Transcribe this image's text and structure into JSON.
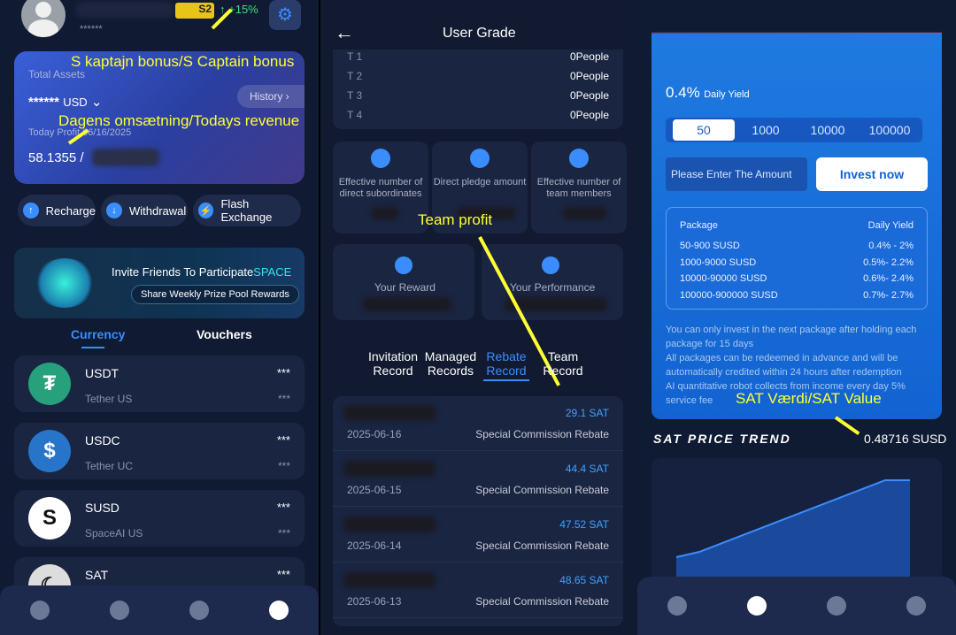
{
  "wallet": {
    "user_id_masked": "******",
    "level_badge": "S2",
    "growth": "+15%",
    "total_assets_label": "Total Assets",
    "assets_masked": "******",
    "currency": "USD",
    "history_label": "History",
    "today_profit_label": "Today Profit",
    "today_profit_date": "06/16/2025",
    "today_profit_value": "58.1355 /",
    "actions": [
      "Recharge",
      "Withdrawal",
      "Flash Exchange"
    ],
    "banner_title": "Invite Friends To Participate",
    "banner_highlight": "SPACE",
    "banner_button": "Share Weekly Prize Pool Rewards",
    "tabs": [
      "Currency",
      "Vouchers"
    ],
    "coins": [
      {
        "symbol": "USDT",
        "name": "Tether US",
        "value": "***",
        "sub": "***"
      },
      {
        "symbol": "USDC",
        "name": "Tether UC",
        "value": "***",
        "sub": "***"
      },
      {
        "symbol": "SUSD",
        "name": "SpaceAI US",
        "value": "***",
        "sub": "***"
      },
      {
        "symbol": "SAT",
        "name": "",
        "value": "***",
        "sub": ""
      }
    ]
  },
  "annotations": {
    "captain": "S kaptajn bonus/S Captain bonus",
    "revenue": "Dagens omsætning/Todays revenue",
    "team": "Team profit",
    "sat": "SAT Værdi/SAT Value"
  },
  "grade": {
    "title": "User Grade",
    "tiers": [
      {
        "t": "T 1",
        "v": "0People"
      },
      {
        "t": "T 2",
        "v": "0People"
      },
      {
        "t": "T 3",
        "v": "0People"
      },
      {
        "t": "T 4",
        "v": "0People"
      }
    ],
    "stats": [
      "Effective number of direct subordinates",
      "Direct pledge amount",
      "Effective number of team members"
    ],
    "reward": "Your Reward",
    "performance": "Your Performance",
    "record_tabs": [
      "Invitation Record",
      "Managed Records",
      "Rebate Record",
      "Team Record"
    ],
    "records": [
      {
        "amount": "29.1 SAT",
        "date": "2025-06-16",
        "type": "Special Commission Rebate"
      },
      {
        "amount": "44.4 SAT",
        "date": "2025-06-15",
        "type": "Special Commission Rebate"
      },
      {
        "amount": "47.52 SAT",
        "date": "2025-06-14",
        "type": "Special Commission Rebate"
      },
      {
        "amount": "48.65 SAT",
        "date": "2025-06-13",
        "type": "Special Commission Rebate"
      }
    ]
  },
  "invest": {
    "yield": "0.4%",
    "yield_label": "Daily Yield",
    "amounts": [
      "50",
      "1000",
      "10000",
      "100000"
    ],
    "placeholder": "Please Enter The Amount",
    "invest_button": "Invest now",
    "pkg_head": "Package",
    "yield_head": "Daily Yield",
    "packages": [
      {
        "p": "50-900 SUSD",
        "y": "0.4% - 2%"
      },
      {
        "p": "1000-9000 SUSD",
        "y": "0.5%- 2.2%"
      },
      {
        "p": "10000-90000 SUSD",
        "y": "0.6%- 2.4%"
      },
      {
        "p": "100000-900000 SUSD",
        "y": "0.7%- 2.7%"
      }
    ],
    "notes": [
      "You can only invest in the next package after holding each package for 15 days",
      "All packages can be redeemed in advance and will be automatically credited within 24 hours after redemption",
      "AI quantitative robot collects from income every day 5% service fee"
    ],
    "trend_title": "SAT PRICE TREND",
    "price": "0.48716 SUSD"
  },
  "colors": {
    "accent": "#3a8dff",
    "annotation": "#ffff33"
  }
}
